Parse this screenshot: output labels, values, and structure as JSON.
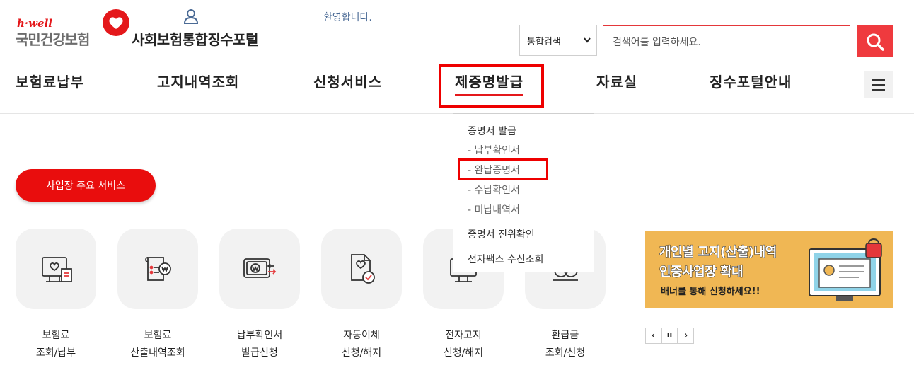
{
  "header": {
    "logo_top": "h·well",
    "logo_name": "국민건강보험",
    "portal_title": "사회보험통합징수포털",
    "welcome": "환영합니다.",
    "user_icon": "user-icon"
  },
  "search": {
    "scope_selected": "통합검색",
    "placeholder": "검색어를 입력하세요.",
    "button_icon": "search-icon"
  },
  "gnb": {
    "items": [
      {
        "label": "보험료납부"
      },
      {
        "label": "고지내역조회"
      },
      {
        "label": "신청서비스"
      },
      {
        "label": "제증명발급"
      },
      {
        "label": "자료실"
      },
      {
        "label": "징수포털안내"
      }
    ],
    "active_index": 3,
    "menu_icon": "hamburger-menu-icon"
  },
  "dropdown": {
    "group_title": "증명서 발급",
    "sub_items": [
      "- 납부확인서",
      "- 완납증명서",
      "- 수납확인서",
      "- 미납내역서"
    ],
    "items": [
      "증명서 진위확인",
      "전자팩스 수신조회"
    ]
  },
  "service_button": "사업장 주요 서비스",
  "services": [
    {
      "line1": "보험료",
      "line2": "조회/납부",
      "icon": "bill-monitor-icon"
    },
    {
      "line1": "보험료",
      "line2": "산출내역조회",
      "icon": "calculation-won-icon"
    },
    {
      "line1": "납부확인서",
      "line2": "발급신청",
      "icon": "payment-certificate-icon"
    },
    {
      "line1": "자동이체",
      "line2": "신청/해지",
      "icon": "auto-transfer-icon"
    },
    {
      "line1": "전자고지",
      "line2": "신청/해지",
      "icon": "electronic-notice-icon"
    },
    {
      "line1": "환급금",
      "line2": "조회/신청",
      "icon": "refund-icon"
    }
  ],
  "banner": {
    "line1": "개인별 고지(산출)내역",
    "line2": "인증사업장 확대",
    "line3": "배너를 통해 신청하세요!!"
  },
  "banner_controls": {
    "prev": "‹",
    "pause": "II",
    "next": "›"
  },
  "colors": {
    "brand_red": "#e90d0d",
    "search_red": "#ef3a3e",
    "banner_bg": "#f0b754",
    "highlight": "#ee0000"
  }
}
